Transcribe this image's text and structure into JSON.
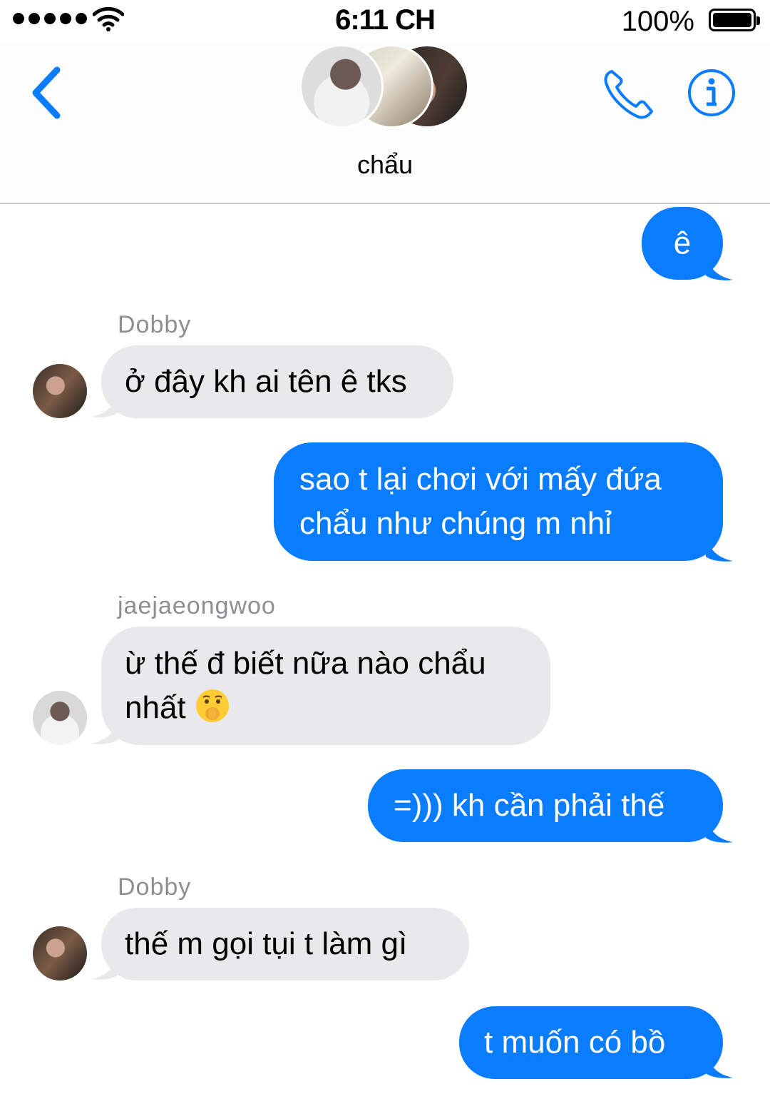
{
  "status_bar": {
    "time": "6:11 CH",
    "battery_percent": "100%"
  },
  "header": {
    "group_name": "chẩu"
  },
  "messages": [
    {
      "dir": "out",
      "text": "ê"
    },
    {
      "dir": "in",
      "sender": "Dobby",
      "text": "ở đây kh ai tên ê tks"
    },
    {
      "dir": "out",
      "line1": "sao t lại chơi với mấy đứa",
      "line2": "chẩu như chúng m nhỉ"
    },
    {
      "dir": "in",
      "sender": "jaejaeongwoo",
      "line1": "ừ thế đ biết nữa nào chẩu",
      "line2": "nhất"
    },
    {
      "dir": "out",
      "text": "=))) kh cần phải thế"
    },
    {
      "dir": "in",
      "sender": "Dobby",
      "text": "thế m gọi tụi t làm gì"
    },
    {
      "dir": "out",
      "text": "t muốn có bồ"
    }
  ],
  "icons": [
    "back-chevron-icon",
    "phone-icon",
    "info-icon",
    "shushing-face-emoji"
  ],
  "colors": {
    "outgoing": "#0a7cff",
    "incoming": "#e9e9eb",
    "accent": "#0a7cff",
    "sender_label": "#8e8e93"
  }
}
